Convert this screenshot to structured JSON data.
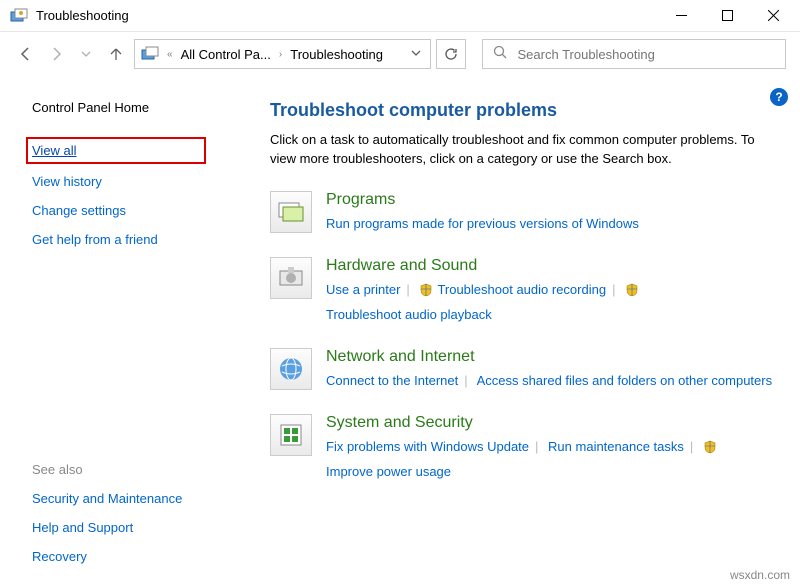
{
  "window": {
    "title": "Troubleshooting"
  },
  "breadcrumb": {
    "item1": "All Control Pa...",
    "item2": "Troubleshooting"
  },
  "search": {
    "placeholder": "Search Troubleshooting"
  },
  "sidebar": {
    "heading": "Control Panel Home",
    "links": [
      {
        "label": "View all"
      },
      {
        "label": "View history"
      },
      {
        "label": "Change settings"
      },
      {
        "label": "Get help from a friend"
      }
    ],
    "seealso_header": "See also",
    "seealso": [
      {
        "label": "Security and Maintenance"
      },
      {
        "label": "Help and Support"
      },
      {
        "label": "Recovery"
      }
    ]
  },
  "main": {
    "title": "Troubleshoot computer problems",
    "description": "Click on a task to automatically troubleshoot and fix common computer problems. To view more troubleshooters, click on a category or use the Search box."
  },
  "categories": [
    {
      "title": "Programs",
      "links": [
        {
          "label": "Run programs made for previous versions of Windows",
          "shield": false
        }
      ]
    },
    {
      "title": "Hardware and Sound",
      "links": [
        {
          "label": "Use a printer",
          "shield": false
        },
        {
          "label": "Troubleshoot audio recording",
          "shield": true
        },
        {
          "label": "Troubleshoot audio playback",
          "shield": true
        }
      ]
    },
    {
      "title": "Network and Internet",
      "links": [
        {
          "label": "Connect to the Internet",
          "shield": false
        },
        {
          "label": "Access shared files and folders on other computers",
          "shield": false
        }
      ]
    },
    {
      "title": "System and Security",
      "links": [
        {
          "label": "Fix problems with Windows Update",
          "shield": false
        },
        {
          "label": "Run maintenance tasks",
          "shield": false
        },
        {
          "label": "Improve power usage",
          "shield": true
        }
      ]
    }
  ],
  "watermark": "wsxdn.com"
}
